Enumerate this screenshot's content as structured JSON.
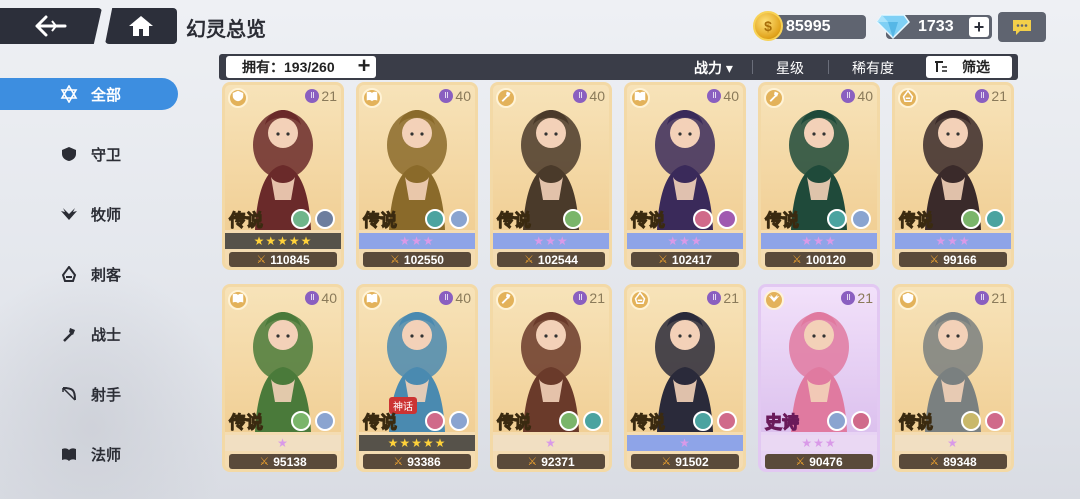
{
  "header": {
    "title": "幻灵总览",
    "gold": "85995",
    "gems": "1733",
    "gem_plus": "+"
  },
  "toolbar": {
    "owned_label": "拥有：193/260",
    "owned_plus": "+",
    "sort_power": "战力 ▾",
    "sort_star": "星级",
    "sort_rarity": "稀有度",
    "filter": "筛选"
  },
  "sidebar": {
    "items": [
      {
        "label": "全部",
        "icon": "star-of-david-icon",
        "active": true
      },
      {
        "label": "守卫",
        "icon": "shield-icon"
      },
      {
        "label": "牧师",
        "icon": "wings-icon"
      },
      {
        "label": "刺客",
        "icon": "hood-icon"
      },
      {
        "label": "战士",
        "icon": "axe-icon"
      },
      {
        "label": "射手",
        "icon": "bow-icon"
      },
      {
        "label": "法师",
        "icon": "book-icon"
      }
    ]
  },
  "colors": {
    "accent": "#3d8ee0",
    "dark": "#2c2f3a",
    "gold_star": "#ffd23a",
    "purple_star": "#d99ae8",
    "legend_card": "#f4dcb2",
    "epic_card": "#e8d4f4"
  },
  "cards": [
    {
      "level": "21",
      "rarity": "传说",
      "stars": "★★★★★",
      "star_style": "gold",
      "power": "110845",
      "class_icon": "shield-icon",
      "elements": [
        "#6fb58a",
        "#6d7e9e"
      ],
      "portrait": "red-haired-demoness",
      "tone": "#6a2a2a"
    },
    {
      "level": "40",
      "rarity": "传说",
      "stars": "★★★",
      "star_style": "purple",
      "power": "102550",
      "class_icon": "book-icon",
      "elements": [
        "#4ba3a0",
        "#8aa4d0"
      ],
      "portrait": "pharaoh-priestess",
      "tone": "#8a6a2a"
    },
    {
      "level": "40",
      "rarity": "传说",
      "stars": "★★★",
      "star_style": "purple",
      "power": "102544",
      "class_icon": "axe-icon",
      "elements": [
        "#7ab56a"
      ],
      "portrait": "minotaur-beast",
      "tone": "#4a3a2a"
    },
    {
      "level": "40",
      "rarity": "传说",
      "stars": "★★★",
      "star_style": "purple",
      "power": "102417",
      "class_icon": "book-icon",
      "elements": [
        "#d06a8a",
        "#a05ab0"
      ],
      "portrait": "dark-elf-sorceress",
      "tone": "#3a2a5a"
    },
    {
      "level": "40",
      "rarity": "传说",
      "stars": "★★★",
      "star_style": "purple",
      "power": "100120",
      "class_icon": "axe-icon",
      "elements": [
        "#4ba3a0",
        "#8aa4d0"
      ],
      "portrait": "green-armored-knight",
      "tone": "#1f4a3a"
    },
    {
      "level": "21",
      "rarity": "传说",
      "stars": "★★★",
      "star_style": "purple",
      "power": "99166",
      "class_icon": "hood-icon",
      "elements": [
        "#7ab56a",
        "#4ba3a0"
      ],
      "portrait": "twin-bun-martial-artist",
      "tone": "#3a2a2a"
    },
    {
      "level": "40",
      "rarity": "传说",
      "stars": "★",
      "star_style": "none",
      "power": "95138",
      "class_icon": "book-icon",
      "elements": [
        "#7ab56a",
        "#8aa4d0"
      ],
      "portrait": "forest-deer-druid",
      "tone": "#4a7a3a"
    },
    {
      "level": "40",
      "rarity": "传说",
      "stars": "★★★★★",
      "star_style": "gold",
      "power": "93386",
      "class_icon": "book-icon",
      "elements": [
        "#d06a8a",
        "#8aa4d0"
      ],
      "portrait": "ice-dragon-maiden",
      "tone": "#4a8ab0",
      "mythic": "神话"
    },
    {
      "level": "21",
      "rarity": "传说",
      "stars": "★",
      "star_style": "none",
      "power": "92371",
      "class_icon": "axe-icon",
      "elements": [
        "#7ab56a",
        "#4ba3a0"
      ],
      "portrait": "shark-hood-warrior",
      "tone": "#6a3a2a"
    },
    {
      "level": "21",
      "rarity": "传说",
      "stars": "★",
      "star_style": "purple",
      "power": "91502",
      "class_icon": "hood-icon",
      "elements": [
        "#4ba3a0",
        "#d06a8a"
      ],
      "portrait": "anubis-guardian",
      "tone": "#2a2a3a"
    },
    {
      "level": "21",
      "rarity": "史诗",
      "stars": "★★★",
      "star_style": "none",
      "power": "90476",
      "class_icon": "wings-icon",
      "elements": [
        "#8aa4d0",
        "#d06a8a"
      ],
      "portrait": "mermaid-princess",
      "tone": "#e07aa0",
      "epic": true
    },
    {
      "level": "21",
      "rarity": "传说",
      "stars": "★",
      "star_style": "none",
      "power": "89348",
      "class_icon": "shield-icon",
      "elements": [
        "#c9b86a",
        "#d06a8a"
      ],
      "portrait": "stone-golem",
      "tone": "#7a8080"
    }
  ]
}
